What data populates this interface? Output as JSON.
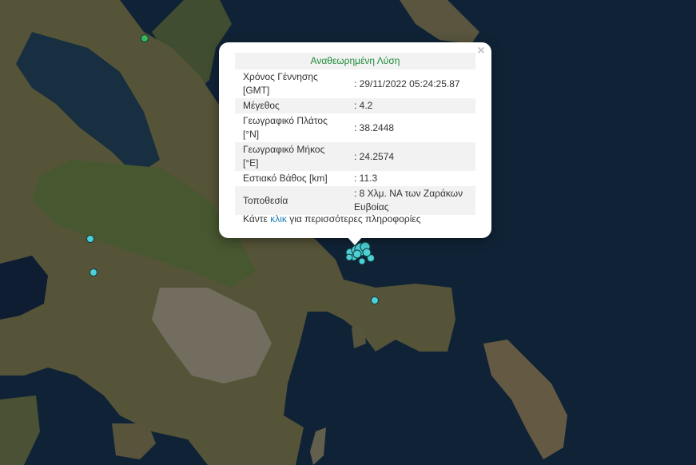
{
  "popup": {
    "title": "Αναθεωρημένη Λύση",
    "close_symbol": "×",
    "rows": [
      {
        "label": "Χρόνος Γέννησης [GMT]",
        "value": ": 29/11/2022 05:24:25.87"
      },
      {
        "label": "Μέγεθος",
        "value": ": 4.2"
      },
      {
        "label": "Γεωγραφικό Πλάτος [°N]",
        "value": ": 38.2448"
      },
      {
        "label": "Γεωγραφικό Μήκος [°E]",
        "value": ": 24.2574"
      },
      {
        "label": "Εστιακό Βάθος [km]",
        "value": ": 11.3"
      },
      {
        "label": "Τοποθεσία",
        "value": ": 8 Χλμ. ΝΑ των Ζαράκων Ευβοίας"
      }
    ],
    "footer_before": "Κάντε ",
    "footer_link": "κλικ",
    "footer_after": " για περισσότερες πληροφορίες"
  },
  "map": {
    "sea_color": "#12263a",
    "land_color": "#5b5a3c",
    "marker_colors": {
      "recent": "#4ecfd6",
      "older": "#39b55a"
    },
    "markers": [
      {
        "type": "older"
      },
      {
        "type": "recent"
      },
      {
        "type": "recent"
      },
      {
        "type": "recent"
      },
      {
        "type": "recent"
      }
    ]
  }
}
